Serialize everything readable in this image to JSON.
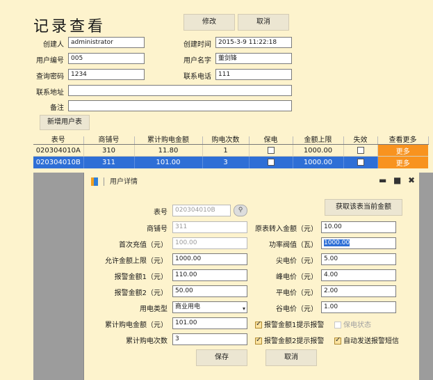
{
  "header": {
    "title": "记录查看",
    "edit_label": "修改",
    "cancel_label": "取消"
  },
  "form": {
    "creator": {
      "label": "创建人",
      "value": "administrator"
    },
    "created_time": {
      "label": "创建时间",
      "value": "2015-3-9 11:22:18"
    },
    "user_no": {
      "label": "用户编号",
      "value": "005"
    },
    "user_name": {
      "label": "用户名字",
      "value": "董剑锋"
    },
    "query_pwd": {
      "label": "查询密码",
      "value": "1234"
    },
    "phone": {
      "label": "联系电话",
      "value": "111"
    },
    "address": {
      "label": "联系地址",
      "value": ""
    },
    "remark": {
      "label": "备注",
      "value": ""
    }
  },
  "add_meter_label": "新增用户表",
  "grid": {
    "columns": [
      "表号",
      "商铺号",
      "累计购电金额",
      "购电次数",
      "保电",
      "金额上限",
      "失效",
      "查看更多"
    ],
    "rows": [
      {
        "meter": "020304010A",
        "shop": "310",
        "amount": "11.80",
        "count": "1",
        "protect": false,
        "limit": "1000.00",
        "invalid": false,
        "more": "更多"
      },
      {
        "meter": "020304010B",
        "shop": "311",
        "amount": "101.00",
        "count": "3",
        "protect": false,
        "limit": "1000.00",
        "invalid": false,
        "more": "更多"
      }
    ]
  },
  "dialog": {
    "title": "用户详情",
    "window_controls": {
      "minimize": "▬",
      "maximize": "■",
      "close": "✖"
    },
    "fetch_label": "获取该表当前金额",
    "fields": {
      "meter_no": {
        "label": "表号",
        "value": "020304010B"
      },
      "shop_no": {
        "label": "商铺号",
        "value": "311"
      },
      "first_charge": {
        "label": "首次充值（元）",
        "value": "100.00"
      },
      "max_allowed": {
        "label": "允许金额上限（元）",
        "value": "1000.00"
      },
      "alarm1": {
        "label": "报警金额1（元）",
        "value": "110.00"
      },
      "alarm2": {
        "label": "报警金额2（元）",
        "value": "50.00"
      },
      "elec_type": {
        "label": "用电类型",
        "value": "商业用电"
      },
      "total_amount": {
        "label": "累计购电金额（元）",
        "value": "101.00"
      },
      "total_count": {
        "label": "累计购电次数",
        "value": "3"
      },
      "orig_transfer": {
        "label": "原表转入金额（元）",
        "value": "10.00"
      },
      "power_threshold": {
        "label": "功率阀值（瓦）",
        "value": "1000.00"
      },
      "sharp_price": {
        "label": "尖电价（元）",
        "value": "5.00"
      },
      "peak_price": {
        "label": "峰电价（元）",
        "value": "4.00"
      },
      "flat_price": {
        "label": "平电价（元）",
        "value": "2.00"
      },
      "valley_price": {
        "label": "谷电价（元）",
        "value": "1.00"
      }
    },
    "checks": {
      "alarm1_notice": {
        "label": "报警金额1提示报警",
        "checked": true,
        "enabled": true
      },
      "protect_status": {
        "label": "保电状态",
        "checked": false,
        "enabled": false
      },
      "alarm2_notice": {
        "label": "报警金额2提示报警",
        "checked": true,
        "enabled": true
      },
      "auto_sms": {
        "label": "自动发送报警短信",
        "checked": true,
        "enabled": true
      }
    },
    "save_label": "保存",
    "cancel_label": "取消"
  }
}
